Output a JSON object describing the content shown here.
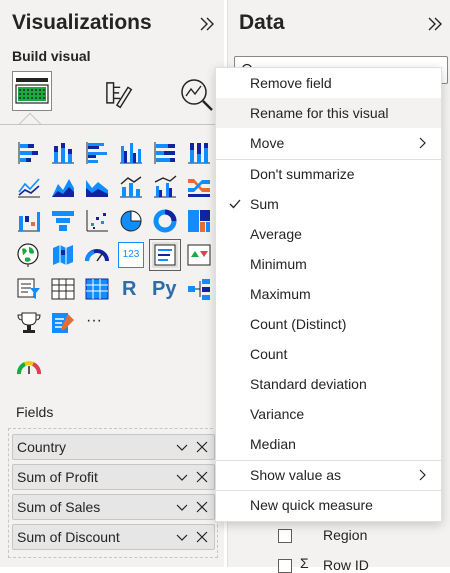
{
  "visualizations": {
    "title": "Visualizations",
    "build_visual_label": "Build visual",
    "fields_label": "Fields",
    "field_wells": [
      {
        "label": "Country"
      },
      {
        "label": "Sum of Profit"
      },
      {
        "label": "Sum of Sales"
      },
      {
        "label": "Sum of Discount"
      }
    ],
    "more_label": "···",
    "r_label": "R",
    "py_label": "Py",
    "table_icon_label": "123",
    "visual_types": [
      "stacked-bar-chart-icon",
      "stacked-column-chart-icon",
      "clustered-bar-chart-icon",
      "clustered-column-chart-icon",
      "100-stacked-bar-chart-icon",
      "100-stacked-column-chart-icon",
      "line-chart-icon",
      "area-chart-icon",
      "stacked-area-chart-icon",
      "line-and-stacked-column-chart-icon",
      "line-and-clustered-column-chart-icon",
      "ribbon-chart-icon",
      "waterfall-chart-icon",
      "funnel-chart-icon",
      "scatter-chart-icon",
      "pie-chart-icon",
      "donut-chart-icon",
      "treemap-icon",
      "map-icon",
      "filled-map-icon",
      "gauge-icon",
      "card-icon",
      "multi-row-card-icon",
      "kpi-icon",
      "slicer-icon",
      "table-icon",
      "matrix-icon",
      "r-script-visual-icon",
      "python-visual-icon",
      "decomposition-tree-icon",
      "key-influencers-icon",
      "smart-narrative-icon",
      "more-visuals-icon"
    ]
  },
  "data_pane": {
    "title": "Data",
    "fields": [
      {
        "label": "Region"
      },
      {
        "label": "Row ID",
        "sigma": "Σ"
      }
    ]
  },
  "context_menu": {
    "items": [
      {
        "label": "Remove field"
      },
      {
        "label": "Rename for this visual",
        "highlighted": true
      },
      {
        "label": "Move",
        "submenu": true
      },
      {
        "label": "Don't summarize"
      },
      {
        "label": "Sum",
        "checked": true
      },
      {
        "label": "Average"
      },
      {
        "label": "Minimum"
      },
      {
        "label": "Maximum"
      },
      {
        "label": "Count (Distinct)"
      },
      {
        "label": "Count"
      },
      {
        "label": "Standard deviation"
      },
      {
        "label": "Variance"
      },
      {
        "label": "Median"
      },
      {
        "label": "Show value as",
        "submenu": true
      },
      {
        "label": "New quick measure"
      }
    ]
  },
  "colors": {
    "accent_blue": "#118dff",
    "dark_blue": "#12239e",
    "orange": "#e66c37",
    "teal": "#1aab40",
    "pane_bg": "#f3f2f1"
  }
}
